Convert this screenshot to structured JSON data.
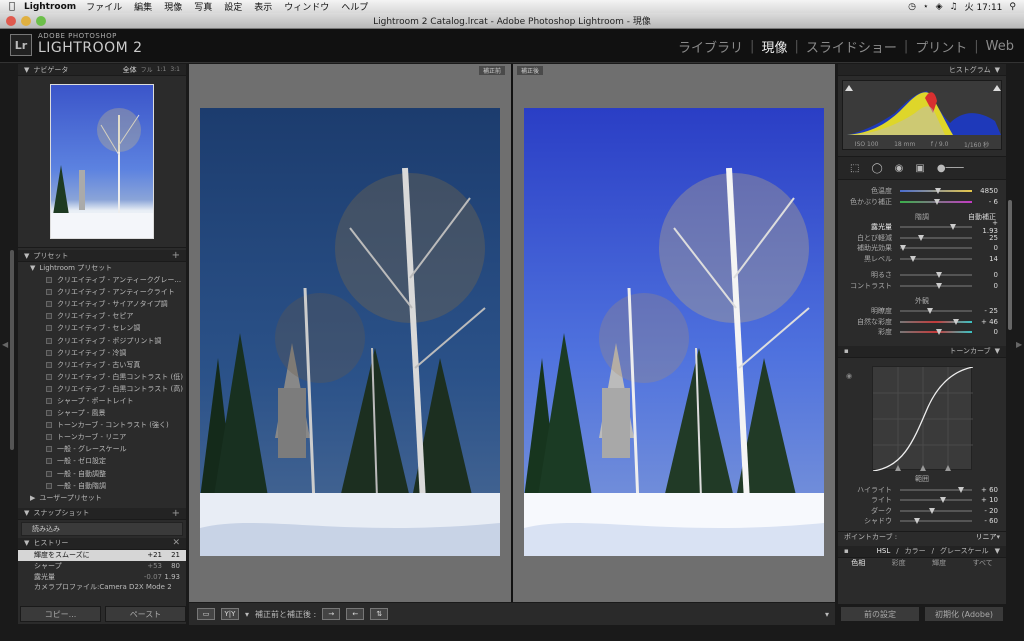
{
  "menubar": {
    "app": "Lightroom",
    "items": [
      "ファイル",
      "編集",
      "現像",
      "写真",
      "設定",
      "表示",
      "ウィンドウ",
      "ヘルプ"
    ],
    "clock": "火 17:11"
  },
  "window_title": "Lightroom 2 Catalog.lrcat - Adobe Photoshop Lightroom - 現像",
  "identity": {
    "logo": "Lr",
    "brand_small": "ADOBE PHOTOSHOP",
    "brand_large": "LIGHTROOM 2",
    "modules": [
      "ライブラリ",
      "現像",
      "スライドショー",
      "プリント",
      "Web"
    ],
    "active_module": "現像"
  },
  "navigator": {
    "title": "ナビゲータ",
    "zoom_options": [
      "全体",
      "フル",
      "1:1",
      "3:1"
    ]
  },
  "presets": {
    "title": "プリセット",
    "group": "Lightroom プリセット",
    "items": [
      "クリエイティブ - アンティークグレー...",
      "クリエイティブ - アンティークライト",
      "クリエイティブ - サイアノタイプ調",
      "クリエイティブ - セピア",
      "クリエイティブ - セレン調",
      "クリエイティブ - ポジプリント調",
      "クリエイティブ - 冷調",
      "クリエイティブ - 古い写真",
      "クリエイティブ - 白黒コントラスト (低)",
      "クリエイティブ - 白黒コントラスト (高)",
      "シャープ - ポートレイト",
      "シャープ - 風景",
      "トーンカーブ - コントラスト (強く)",
      "トーンカーブ - リニア",
      "一般 - グレースケール",
      "一般 - ゼロ設定",
      "一般 - 自動調整",
      "一般 - 自動階調"
    ],
    "user_group": "ユーザープリセット"
  },
  "snapshot": {
    "title": "スナップショット",
    "item": "読み込み"
  },
  "history": {
    "title": "ヒストリー",
    "rows": [
      {
        "label": "輝度をスムーズに",
        "delta": "+21",
        "value": "21"
      },
      {
        "label": "シャープ",
        "delta": "+53",
        "value": "80"
      },
      {
        "label": "露光量",
        "delta": "-0.07",
        "value": "1.93"
      },
      {
        "label": "カメラプロファイル:Camera D2X Mode 2",
        "delta": "",
        "value": ""
      }
    ]
  },
  "left_buttons": {
    "copy": "コピー...",
    "paste": "ペースト"
  },
  "views": {
    "before": "補正前",
    "after": "補正後"
  },
  "toolbar": {
    "view_mode": "Y|Y",
    "label": "補正前と補正後 :"
  },
  "histogram": {
    "title": "ヒストグラム",
    "iso": "ISO 100",
    "focal": "18 mm",
    "aperture": "f / 9.0",
    "shutter": "1/160 秒"
  },
  "basic": {
    "wb_rows": [
      {
        "label": "色温度",
        "value": "4850",
        "pos": 0.48
      },
      {
        "label": "色かぶり補正",
        "value": "- 6",
        "pos": 0.47
      }
    ],
    "tone_title": "階調",
    "auto": "自動補正",
    "tone_rows": [
      {
        "label": "露光量",
        "value": "+ 1.93",
        "pos": 0.69
      },
      {
        "label": "白とび軽減",
        "value": "25",
        "pos": 0.25
      },
      {
        "label": "補助光効果",
        "value": "0",
        "pos": 0.0
      },
      {
        "label": "黒レベル",
        "value": "14",
        "pos": 0.14
      }
    ],
    "tone_rows2": [
      {
        "label": "明るさ",
        "value": "0",
        "pos": 0.5
      },
      {
        "label": "コントラスト",
        "value": "0",
        "pos": 0.5
      }
    ],
    "presence_title": "外観",
    "presence_rows": [
      {
        "label": "明瞭度",
        "value": "- 25",
        "pos": 0.38
      },
      {
        "label": "自然な彩度",
        "value": "+ 46",
        "pos": 0.73
      },
      {
        "label": "彩度",
        "value": "0",
        "pos": 0.5
      }
    ]
  },
  "tonecurve": {
    "title": "トーンカーブ",
    "region_title": "範囲",
    "rows": [
      {
        "label": "ハイライト",
        "value": "+ 60",
        "pos": 0.8
      },
      {
        "label": "ライト",
        "value": "+ 10",
        "pos": 0.55
      },
      {
        "label": "ダーク",
        "value": "- 20",
        "pos": 0.4
      },
      {
        "label": "シャドウ",
        "value": "- 60",
        "pos": 0.2
      }
    ],
    "point_curve_label": "ポイントカーブ :",
    "point_curve_value": "リニア"
  },
  "hsl": {
    "tabs": [
      "HSL",
      "カラー",
      "グレースケール"
    ],
    "subtabs": [
      "色相",
      "彩度",
      "輝度",
      "すべて"
    ]
  },
  "right_buttons": {
    "previous": "前の設定",
    "reset": "初期化 (Adobe)"
  },
  "colors": {
    "accent": "#3a3a3a",
    "bg": "#6f6f6f"
  }
}
